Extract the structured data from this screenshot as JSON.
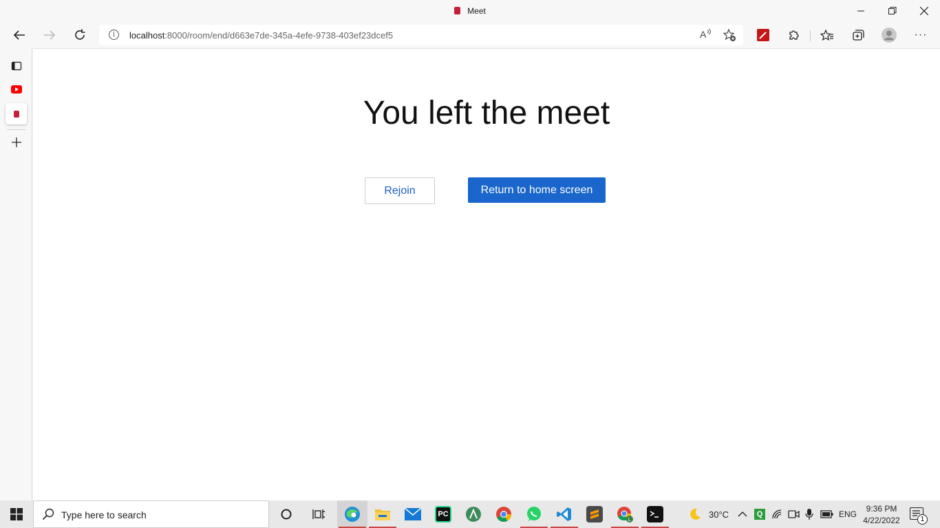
{
  "window": {
    "title": "Meet",
    "minimize_glyph": "─",
    "restore_glyph": "❐",
    "close_glyph": "✕"
  },
  "toolbar": {
    "back_glyph": "←",
    "forward_glyph": "→",
    "refresh_glyph": "↻",
    "url_host": "localhost",
    "url_rest": ":8000/room/end/d663e7de-345a-4efe-9738-403ef23dcef5",
    "read_aloud_glyph": "A³",
    "favorite_glyph": "☆",
    "favorites_glyph": "☆",
    "collections_glyph": "⧉",
    "more_glyph": "···"
  },
  "page": {
    "heading": "You left the meet",
    "rejoin_label": "Rejoin",
    "home_label": "Return to home screen"
  },
  "taskbar": {
    "search_placeholder": "Type here to search",
    "weather": "30°C",
    "language": "ENG",
    "time": "9:36 PM",
    "date": "4/22/2022",
    "notification_count": "1"
  },
  "colors": {
    "primary_button": "#1a66cc",
    "rejoin_text": "#1a5fc7",
    "brand_red": "#c4203a"
  }
}
